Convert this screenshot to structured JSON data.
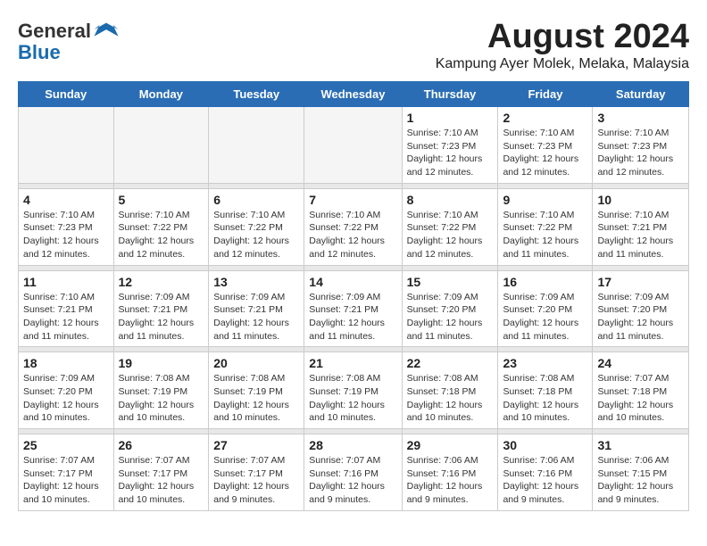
{
  "header": {
    "logo_general": "General",
    "logo_blue": "Blue",
    "month_year": "August 2024",
    "location": "Kampung Ayer Molek, Melaka, Malaysia"
  },
  "days_of_week": [
    "Sunday",
    "Monday",
    "Tuesday",
    "Wednesday",
    "Thursday",
    "Friday",
    "Saturday"
  ],
  "weeks": [
    [
      {
        "day": "",
        "info": ""
      },
      {
        "day": "",
        "info": ""
      },
      {
        "day": "",
        "info": ""
      },
      {
        "day": "",
        "info": ""
      },
      {
        "day": "1",
        "info": "Sunrise: 7:10 AM\nSunset: 7:23 PM\nDaylight: 12 hours\nand 12 minutes."
      },
      {
        "day": "2",
        "info": "Sunrise: 7:10 AM\nSunset: 7:23 PM\nDaylight: 12 hours\nand 12 minutes."
      },
      {
        "day": "3",
        "info": "Sunrise: 7:10 AM\nSunset: 7:23 PM\nDaylight: 12 hours\nand 12 minutes."
      }
    ],
    [
      {
        "day": "4",
        "info": "Sunrise: 7:10 AM\nSunset: 7:23 PM\nDaylight: 12 hours\nand 12 minutes."
      },
      {
        "day": "5",
        "info": "Sunrise: 7:10 AM\nSunset: 7:22 PM\nDaylight: 12 hours\nand 12 minutes."
      },
      {
        "day": "6",
        "info": "Sunrise: 7:10 AM\nSunset: 7:22 PM\nDaylight: 12 hours\nand 12 minutes."
      },
      {
        "day": "7",
        "info": "Sunrise: 7:10 AM\nSunset: 7:22 PM\nDaylight: 12 hours\nand 12 minutes."
      },
      {
        "day": "8",
        "info": "Sunrise: 7:10 AM\nSunset: 7:22 PM\nDaylight: 12 hours\nand 12 minutes."
      },
      {
        "day": "9",
        "info": "Sunrise: 7:10 AM\nSunset: 7:22 PM\nDaylight: 12 hours\nand 11 minutes."
      },
      {
        "day": "10",
        "info": "Sunrise: 7:10 AM\nSunset: 7:21 PM\nDaylight: 12 hours\nand 11 minutes."
      }
    ],
    [
      {
        "day": "11",
        "info": "Sunrise: 7:10 AM\nSunset: 7:21 PM\nDaylight: 12 hours\nand 11 minutes."
      },
      {
        "day": "12",
        "info": "Sunrise: 7:09 AM\nSunset: 7:21 PM\nDaylight: 12 hours\nand 11 minutes."
      },
      {
        "day": "13",
        "info": "Sunrise: 7:09 AM\nSunset: 7:21 PM\nDaylight: 12 hours\nand 11 minutes."
      },
      {
        "day": "14",
        "info": "Sunrise: 7:09 AM\nSunset: 7:21 PM\nDaylight: 12 hours\nand 11 minutes."
      },
      {
        "day": "15",
        "info": "Sunrise: 7:09 AM\nSunset: 7:20 PM\nDaylight: 12 hours\nand 11 minutes."
      },
      {
        "day": "16",
        "info": "Sunrise: 7:09 AM\nSunset: 7:20 PM\nDaylight: 12 hours\nand 11 minutes."
      },
      {
        "day": "17",
        "info": "Sunrise: 7:09 AM\nSunset: 7:20 PM\nDaylight: 12 hours\nand 11 minutes."
      }
    ],
    [
      {
        "day": "18",
        "info": "Sunrise: 7:09 AM\nSunset: 7:20 PM\nDaylight: 12 hours\nand 10 minutes."
      },
      {
        "day": "19",
        "info": "Sunrise: 7:08 AM\nSunset: 7:19 PM\nDaylight: 12 hours\nand 10 minutes."
      },
      {
        "day": "20",
        "info": "Sunrise: 7:08 AM\nSunset: 7:19 PM\nDaylight: 12 hours\nand 10 minutes."
      },
      {
        "day": "21",
        "info": "Sunrise: 7:08 AM\nSunset: 7:19 PM\nDaylight: 12 hours\nand 10 minutes."
      },
      {
        "day": "22",
        "info": "Sunrise: 7:08 AM\nSunset: 7:18 PM\nDaylight: 12 hours\nand 10 minutes."
      },
      {
        "day": "23",
        "info": "Sunrise: 7:08 AM\nSunset: 7:18 PM\nDaylight: 12 hours\nand 10 minutes."
      },
      {
        "day": "24",
        "info": "Sunrise: 7:07 AM\nSunset: 7:18 PM\nDaylight: 12 hours\nand 10 minutes."
      }
    ],
    [
      {
        "day": "25",
        "info": "Sunrise: 7:07 AM\nSunset: 7:17 PM\nDaylight: 12 hours\nand 10 minutes."
      },
      {
        "day": "26",
        "info": "Sunrise: 7:07 AM\nSunset: 7:17 PM\nDaylight: 12 hours\nand 10 minutes."
      },
      {
        "day": "27",
        "info": "Sunrise: 7:07 AM\nSunset: 7:17 PM\nDaylight: 12 hours\nand 9 minutes."
      },
      {
        "day": "28",
        "info": "Sunrise: 7:07 AM\nSunset: 7:16 PM\nDaylight: 12 hours\nand 9 minutes."
      },
      {
        "day": "29",
        "info": "Sunrise: 7:06 AM\nSunset: 7:16 PM\nDaylight: 12 hours\nand 9 minutes."
      },
      {
        "day": "30",
        "info": "Sunrise: 7:06 AM\nSunset: 7:16 PM\nDaylight: 12 hours\nand 9 minutes."
      },
      {
        "day": "31",
        "info": "Sunrise: 7:06 AM\nSunset: 7:15 PM\nDaylight: 12 hours\nand 9 minutes."
      }
    ]
  ]
}
